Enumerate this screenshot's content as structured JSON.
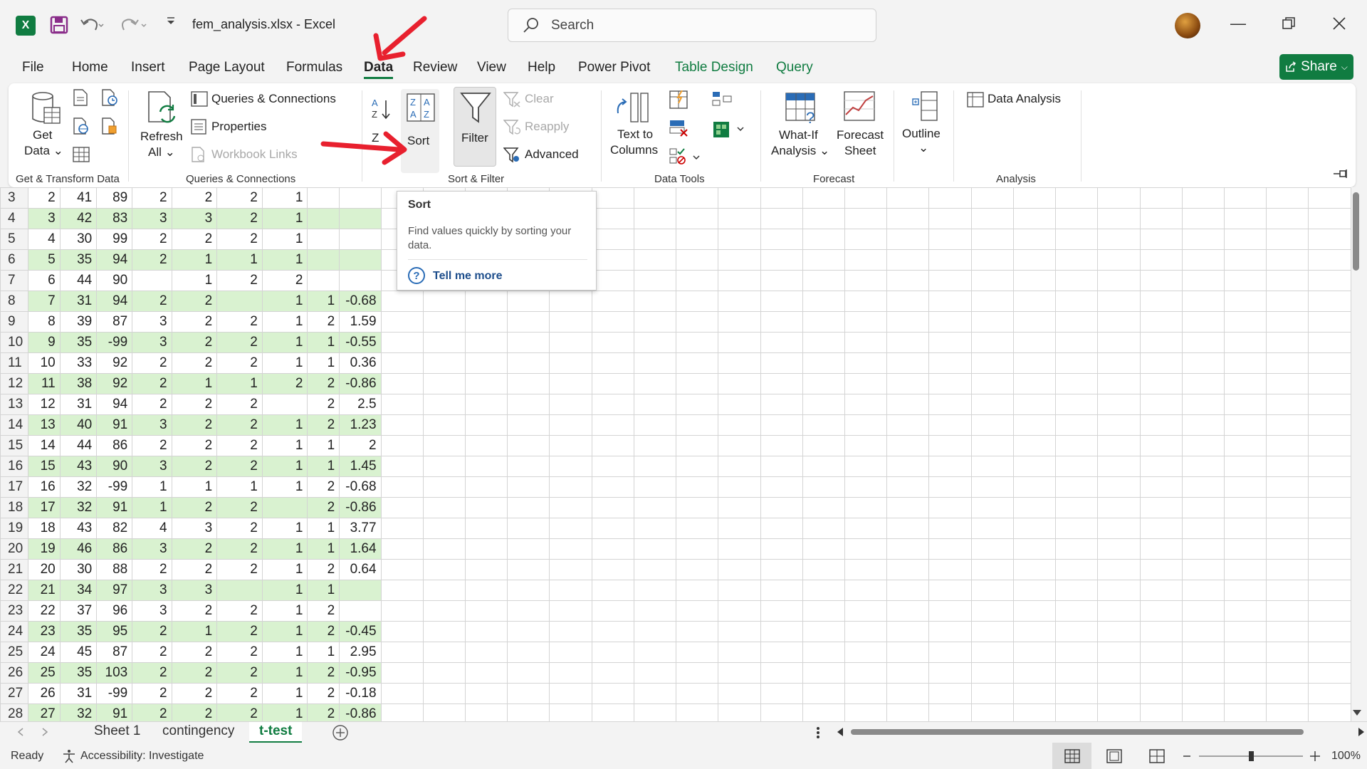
{
  "title_bar": {
    "doc_title": "fem_analysis.xlsx  -  Excel",
    "search_placeholder": "Search"
  },
  "menu": {
    "items": [
      "File",
      "Home",
      "Insert",
      "Page Layout",
      "Formulas",
      "Data",
      "Review",
      "View",
      "Help",
      "Power Pivot",
      "Table Design",
      "Query"
    ],
    "active": "Data",
    "share_label": "Share"
  },
  "ribbon": {
    "get_data_1": "Get",
    "get_data_2": "Data",
    "refresh_1": "Refresh",
    "refresh_2": "All",
    "queries_connections": "Queries & Connections",
    "properties": "Properties",
    "workbook_links": "Workbook Links",
    "sort": "Sort",
    "sort_za_1": "Z",
    "filter": "Filter",
    "clear": "Clear",
    "reapply": "Reapply",
    "advanced": "Advanced",
    "text_to_columns_1": "Text to",
    "text_to_columns_2": "Columns",
    "what_if_1": "What-If",
    "what_if_2": "Analysis",
    "forecast_1": "Forecast",
    "forecast_2": "Sheet",
    "outline": "Outline",
    "data_analysis": "Data Analysis",
    "groups": {
      "get_transform": "Get & Transform Data",
      "queries": "Queries & Connections",
      "sort_filter": "Sort & Filter",
      "data_tools": "Data Tools",
      "forecast": "Forecast",
      "analysis": "Analysis"
    }
  },
  "tooltip": {
    "title": "Sort",
    "description": "Find values quickly by sorting your data.",
    "link": "Tell me more"
  },
  "sheet": {
    "rows": [
      {
        "n": "3",
        "c": [
          "2",
          "41",
          "89",
          "2",
          "2",
          "2",
          "1",
          "",
          ""
        ]
      },
      {
        "n": "4",
        "c": [
          "3",
          "42",
          "83",
          "3",
          "3",
          "2",
          "1",
          "",
          ""
        ]
      },
      {
        "n": "5",
        "c": [
          "4",
          "30",
          "99",
          "2",
          "2",
          "2",
          "1",
          "",
          ""
        ]
      },
      {
        "n": "6",
        "c": [
          "5",
          "35",
          "94",
          "2",
          "1",
          "1",
          "1",
          "",
          ""
        ]
      },
      {
        "n": "7",
        "c": [
          "6",
          "44",
          "90",
          "",
          "1",
          "2",
          "2",
          "",
          ""
        ]
      },
      {
        "n": "8",
        "c": [
          "7",
          "31",
          "94",
          "2",
          "2",
          "",
          "1",
          "1",
          "-0.68"
        ]
      },
      {
        "n": "9",
        "c": [
          "8",
          "39",
          "87",
          "3",
          "2",
          "2",
          "1",
          "2",
          "1.59"
        ]
      },
      {
        "n": "10",
        "c": [
          "9",
          "35",
          "-99",
          "3",
          "2",
          "2",
          "1",
          "1",
          "-0.55"
        ]
      },
      {
        "n": "11",
        "c": [
          "10",
          "33",
          "92",
          "2",
          "2",
          "2",
          "1",
          "1",
          "0.36"
        ]
      },
      {
        "n": "12",
        "c": [
          "11",
          "38",
          "92",
          "2",
          "1",
          "1",
          "2",
          "2",
          "-0.86"
        ]
      },
      {
        "n": "13",
        "c": [
          "12",
          "31",
          "94",
          "2",
          "2",
          "2",
          "",
          "2",
          "2.5"
        ]
      },
      {
        "n": "14",
        "c": [
          "13",
          "40",
          "91",
          "3",
          "2",
          "2",
          "1",
          "2",
          "1.23"
        ]
      },
      {
        "n": "15",
        "c": [
          "14",
          "44",
          "86",
          "2",
          "2",
          "2",
          "1",
          "1",
          "2"
        ]
      },
      {
        "n": "16",
        "c": [
          "15",
          "43",
          "90",
          "3",
          "2",
          "2",
          "1",
          "1",
          "1.45"
        ]
      },
      {
        "n": "17",
        "c": [
          "16",
          "32",
          "-99",
          "1",
          "1",
          "1",
          "1",
          "2",
          "-0.68"
        ]
      },
      {
        "n": "18",
        "c": [
          "17",
          "32",
          "91",
          "1",
          "2",
          "2",
          "",
          "2",
          "-0.86"
        ]
      },
      {
        "n": "19",
        "c": [
          "18",
          "43",
          "82",
          "4",
          "3",
          "2",
          "1",
          "1",
          "3.77"
        ]
      },
      {
        "n": "20",
        "c": [
          "19",
          "46",
          "86",
          "3",
          "2",
          "2",
          "1",
          "1",
          "1.64"
        ]
      },
      {
        "n": "21",
        "c": [
          "20",
          "30",
          "88",
          "2",
          "2",
          "2",
          "1",
          "2",
          "0.64"
        ]
      },
      {
        "n": "22",
        "c": [
          "21",
          "34",
          "97",
          "3",
          "3",
          "",
          "1",
          "1",
          ""
        ]
      },
      {
        "n": "23",
        "c": [
          "22",
          "37",
          "96",
          "3",
          "2",
          "2",
          "1",
          "2",
          ""
        ]
      },
      {
        "n": "24",
        "c": [
          "23",
          "35",
          "95",
          "2",
          "1",
          "2",
          "1",
          "2",
          "-0.45"
        ]
      },
      {
        "n": "25",
        "c": [
          "24",
          "45",
          "87",
          "2",
          "2",
          "2",
          "1",
          "1",
          "2.95"
        ]
      },
      {
        "n": "26",
        "c": [
          "25",
          "35",
          "103",
          "2",
          "2",
          "2",
          "1",
          "2",
          "-0.95"
        ]
      },
      {
        "n": "27",
        "c": [
          "26",
          "31",
          "-99",
          "2",
          "2",
          "2",
          "1",
          "2",
          "-0.18"
        ]
      },
      {
        "n": "28",
        "c": [
          "27",
          "32",
          "91",
          "2",
          "2",
          "2",
          "1",
          "2",
          "-0.86"
        ]
      }
    ]
  },
  "sheet_tabs": {
    "tabs": [
      "Sheet 1",
      "contingency",
      "t-test"
    ],
    "active": "t-test"
  },
  "status": {
    "ready": "Ready",
    "accessibility": "Accessibility: Investigate",
    "zoom": "100%"
  },
  "colors": {
    "excel_green": "#107c41",
    "band_green": "#d9f2d0",
    "annotation_red": "#e8202e"
  }
}
